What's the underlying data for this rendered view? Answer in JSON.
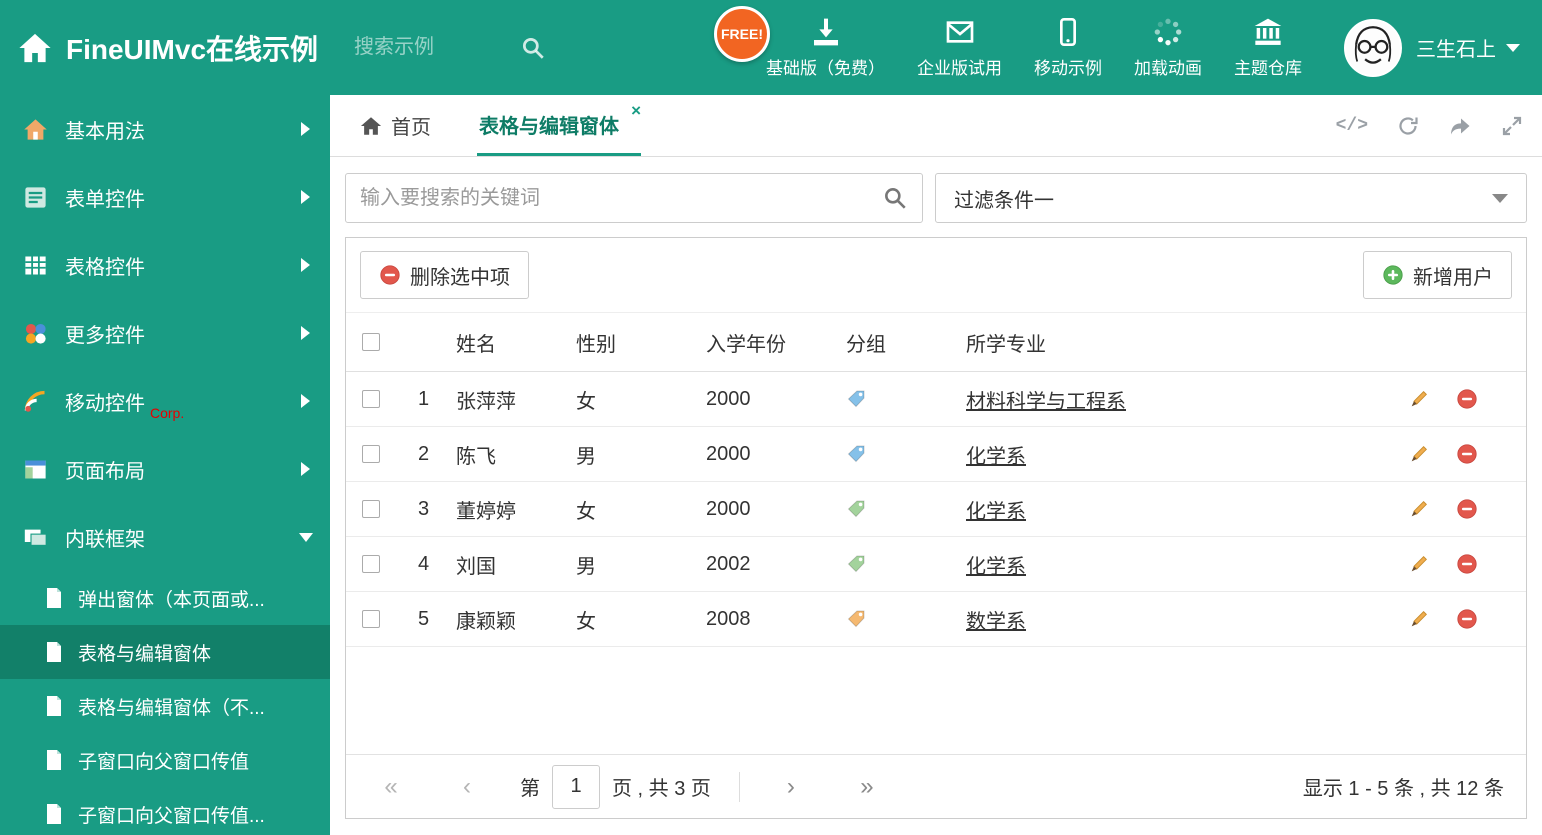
{
  "colors": {
    "primary": "#199c84",
    "primary_dark": "#128069",
    "free_badge": "#f26522",
    "danger": "#e2574c",
    "success": "#5cb85c"
  },
  "header": {
    "title": "FineUIMvc在线示例",
    "search_placeholder": "搜索示例",
    "free_badge": "FREE!",
    "nav": [
      {
        "label": "基础版（免费）"
      },
      {
        "label": "企业版试用"
      },
      {
        "label": "移动示例"
      },
      {
        "label": "加载动画"
      },
      {
        "label": "主题仓库"
      }
    ],
    "user": "三生石上"
  },
  "sidebar": {
    "items": [
      {
        "label": "基本用法"
      },
      {
        "label": "表单控件"
      },
      {
        "label": "表格控件"
      },
      {
        "label": "更多控件"
      },
      {
        "label": "移动控件",
        "badge": "Corp."
      },
      {
        "label": "页面布局"
      },
      {
        "label": "内联框架"
      }
    ],
    "subitems": [
      {
        "label": "弹出窗体（本页面或..."
      },
      {
        "label": "表格与编辑窗体"
      },
      {
        "label": "表格与编辑窗体（不..."
      },
      {
        "label": "子窗口向父窗口传值"
      },
      {
        "label": "子窗口向父窗口传值..."
      }
    ]
  },
  "tabs": {
    "home": "首页",
    "active": "表格与编辑窗体",
    "close": "×"
  },
  "filter": {
    "search_placeholder": "输入要搜索的关键词",
    "dropdown": "过滤条件一"
  },
  "toolbar": {
    "delete": "删除选中项",
    "add": "新增用户"
  },
  "table": {
    "headers": {
      "name": "姓名",
      "gender": "性别",
      "year": "入学年份",
      "group": "分组",
      "major": "所学专业"
    },
    "rows": [
      {
        "num": "1",
        "name": "张萍萍",
        "gender": "女",
        "year": "2000",
        "tag_color": "#85c1e9",
        "major": "材料科学与工程系"
      },
      {
        "num": "2",
        "name": "陈飞",
        "gender": "男",
        "year": "2000",
        "tag_color": "#85c1e9",
        "major": "化学系"
      },
      {
        "num": "3",
        "name": "董婷婷",
        "gender": "女",
        "year": "2000",
        "tag_color": "#a3d39c",
        "major": "化学系"
      },
      {
        "num": "4",
        "name": "刘国",
        "gender": "男",
        "year": "2002",
        "tag_color": "#a3d39c",
        "major": "化学系"
      },
      {
        "num": "5",
        "name": "康颖颖",
        "gender": "女",
        "year": "2008",
        "tag_color": "#f5b971",
        "major": "数学系"
      }
    ]
  },
  "pagination": {
    "first": "«",
    "prev": "‹",
    "next": "›",
    "last": "»",
    "prefix": "第",
    "page": "1",
    "suffix": "页 , 共 3 页",
    "summary": "显示 1 - 5 条 , 共 12 条"
  }
}
